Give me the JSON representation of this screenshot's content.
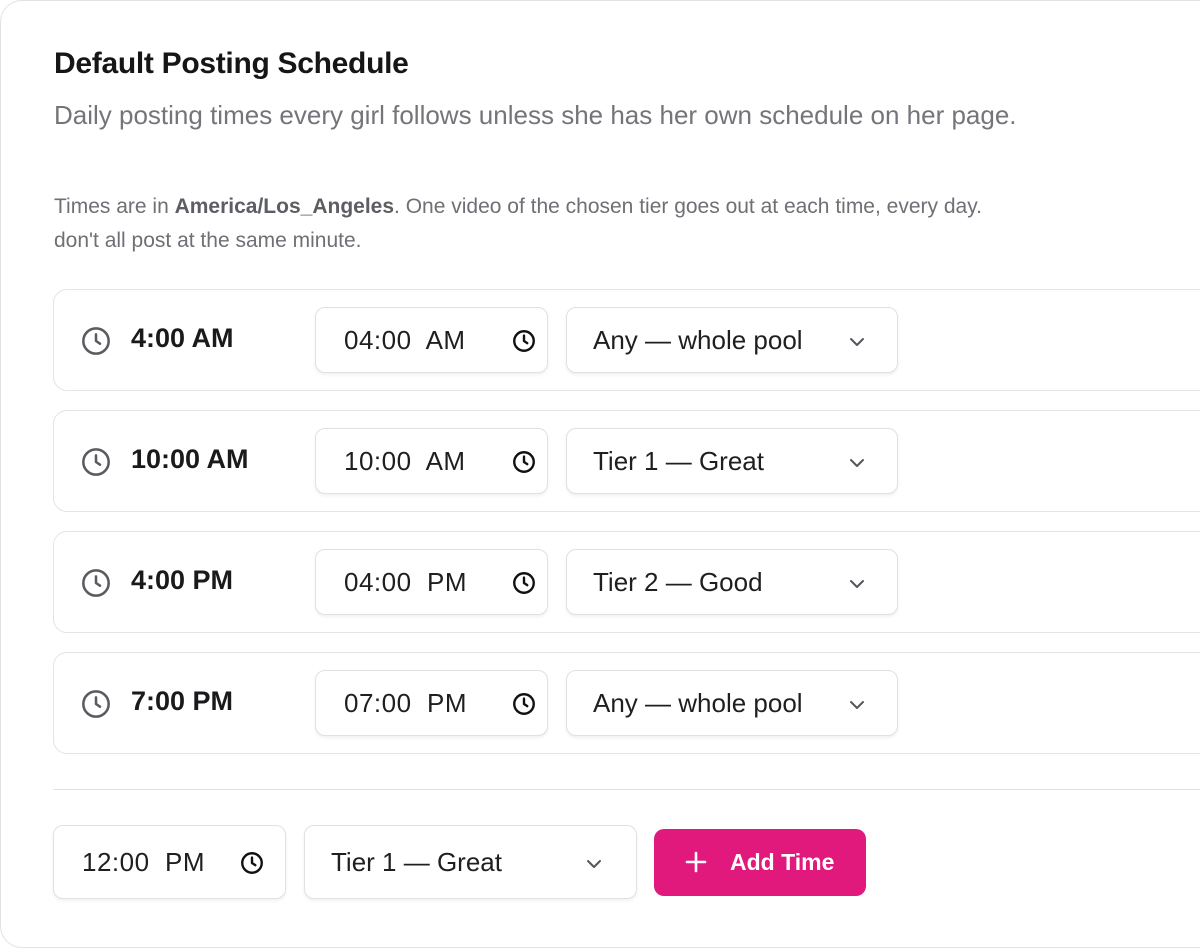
{
  "card": {
    "title": "Default Posting Schedule",
    "subtitle": "Daily posting times every girl follows unless she has her own schedule on her page.",
    "info": {
      "prefix": "Times are in ",
      "timezone": "America/Los_Angeles",
      "rest": ". One video of the chosen tier goes out at each time, every day.",
      "line2": "don't all post at the same minute."
    }
  },
  "schedule": [
    {
      "label": "4:00 AM",
      "time": "04:00  AM",
      "tier": "Any — whole pool"
    },
    {
      "label": "10:00 AM",
      "time": "10:00  AM",
      "tier": "Tier 1 — Great"
    },
    {
      "label": "4:00 PM",
      "time": "04:00  PM",
      "tier": "Tier 2 — Good"
    },
    {
      "label": "7:00 PM",
      "time": "07:00  PM",
      "tier": "Any — whole pool"
    }
  ],
  "new_entry": {
    "time": "12:00  PM",
    "tier": "Tier 1 — Great",
    "add_label": "Add Time"
  },
  "colors": {
    "accent": "#e1197d",
    "border": "#e2e2e6",
    "muted_text": "#74747a"
  },
  "icons": {
    "row": "clock-icon",
    "time_input": "clock-icon",
    "select": "chevron-down-icon",
    "add": "plus-icon"
  }
}
